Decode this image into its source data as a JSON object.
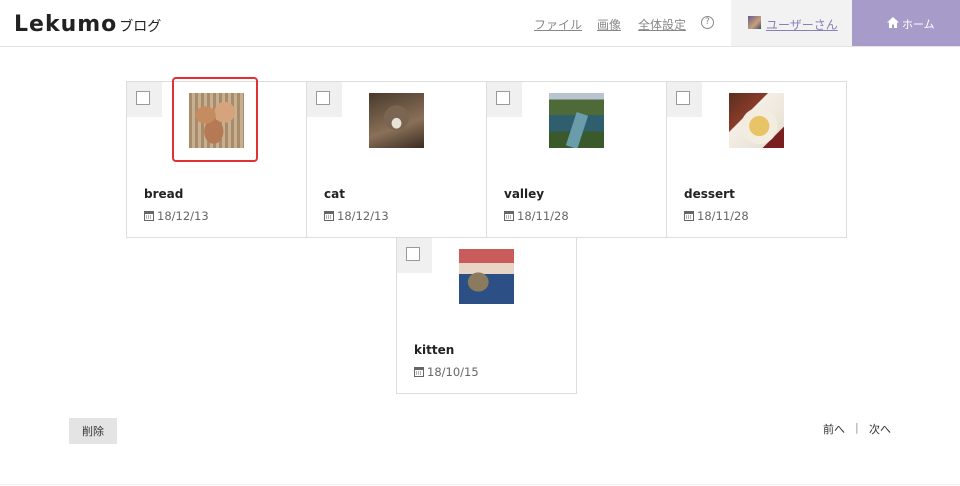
{
  "header": {
    "logo_main": "Lekumo",
    "logo_sub": "ブログ",
    "nav": [
      "ファイル",
      "画像",
      "全体設定"
    ],
    "help_icon": "?",
    "user_name": "ユーザーさん",
    "home_label": "ホーム"
  },
  "images": [
    {
      "title": "bread",
      "date": "18/12/13",
      "icon": "bread-thumbnail",
      "selected": true
    },
    {
      "title": "cat",
      "date": "18/12/13",
      "icon": "cat-thumbnail",
      "selected": false
    },
    {
      "title": "valley",
      "date": "18/11/28",
      "icon": "valley-thumbnail",
      "selected": false
    },
    {
      "title": "dessert",
      "date": "18/11/28",
      "icon": "dessert-thumbnail",
      "selected": false
    },
    {
      "title": "kitten",
      "date": "18/10/15",
      "icon": "kitten-thumbnail",
      "selected": false
    }
  ],
  "actions": {
    "delete_label": "削除",
    "prev_label": "前へ",
    "separator": "|",
    "next_label": "次へ"
  },
  "colors": {
    "accent": "#a79cc9",
    "selection": "#e0303a",
    "user_link": "#8a7fb8"
  }
}
